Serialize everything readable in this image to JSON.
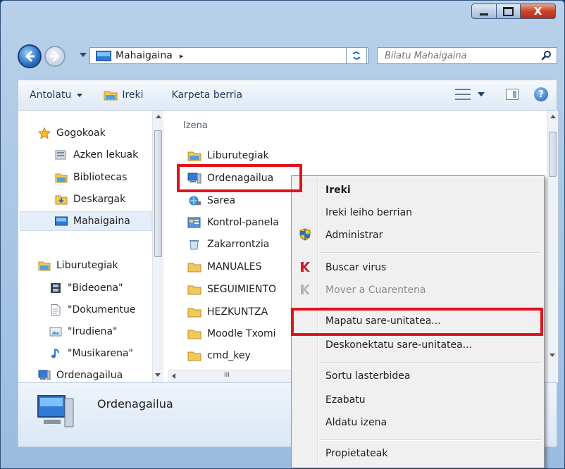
{
  "window": {
    "caption": {
      "minimize": "minimize",
      "maximize": "maximize",
      "close_glyph": "X"
    }
  },
  "address_bar": {
    "location_icon": "desktop-icon",
    "location": "Mahaigaina",
    "separator": "▸"
  },
  "search": {
    "placeholder": "Bilatu Mahaigaina"
  },
  "toolbar": {
    "organize": "Antolatu",
    "open": "Ireki",
    "new_folder": "Karpeta berria"
  },
  "nav_pane": {
    "favorites": {
      "label": "Gogokoak",
      "items": [
        "Azken lekuak",
        "Bibliotecas",
        "Deskargak",
        "Mahaigaina"
      ]
    },
    "libraries": {
      "label": "Liburutegiak",
      "items": [
        "\"Bideoena\"",
        "\"Dokumentue",
        "\"Irudiena\"",
        "\"Musikarena\""
      ]
    },
    "computer": "Ordenagailua"
  },
  "file_pane": {
    "column_header": "Izena",
    "items": [
      "Liburutegiak",
      "Ordenagailua",
      "Sarea",
      "Kontrol-panela",
      "Zakarrontzia",
      "MANUALES",
      "SEGUIMIENTO",
      "HEZKUNTZA",
      "Moodle Txomi",
      "cmd_key"
    ],
    "scroll_grip": "III"
  },
  "details_pane": {
    "name": "Ordenagailua"
  },
  "context_menu": {
    "items": [
      {
        "label": "Ireki",
        "bold": true
      },
      {
        "label": "Ireki leiho berrian"
      },
      {
        "label": "Administrar",
        "icon": "uac-shield-icon"
      },
      {
        "label": "Buscar virus",
        "icon": "kaspersky-icon"
      },
      {
        "label": "Mover a Cuarentena",
        "icon": "kaspersky-icon",
        "disabled": true
      },
      {
        "label": "Mapatu sare-unitatea..."
      },
      {
        "label": "Deskonektatu sare-unitatea..."
      },
      {
        "label": "Sortu lasterbidea"
      },
      {
        "label": "Ezabatu"
      },
      {
        "label": "Aldatu izena"
      },
      {
        "label": "Propietateak"
      }
    ]
  },
  "colors": {
    "highlight_box": "#e0141c",
    "selection": "#e5eef8",
    "toolbar_text": "#1e395b"
  }
}
